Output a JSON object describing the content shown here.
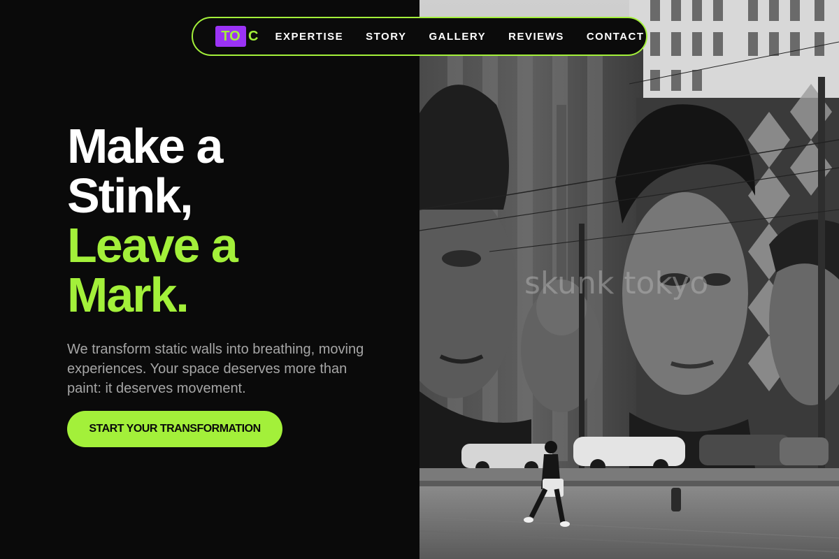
{
  "nav": {
    "logo_box_text": "TO",
    "logo_suffix": "C",
    "links": [
      "EXPERTISE",
      "STORY",
      "GALLERY",
      "REVIEWS",
      "CONTACT"
    ]
  },
  "hero": {
    "headline_line1": "Make a",
    "headline_line2": "Stink,",
    "headline_line3": "Leave a",
    "headline_line4": "Mark.",
    "subtext": "We transform static walls into breathing, moving experiences. Your space deserves more than paint: it deserves movement.",
    "cta_label": "START YOUR TRANSFORMATION"
  },
  "photo": {
    "watermark": "skunk tokyo",
    "description_icon": "street-mural-photo"
  },
  "colors": {
    "accent_green": "#a3f03a",
    "logo_purple": "#9b33f5",
    "background": "#0a0a0a"
  }
}
